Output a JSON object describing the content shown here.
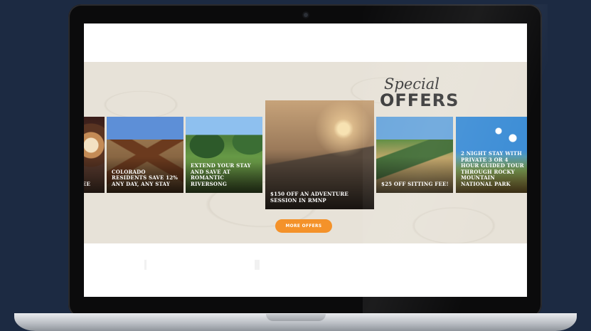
{
  "special": {
    "script": "Special",
    "offers": "OFFERS"
  },
  "offers": [
    {
      "caption": "EE"
    },
    {
      "caption": "COLORADO RESIDENTS SAVE 12% ANY DAY, ANY STAY"
    },
    {
      "caption": "EXTEND YOUR STAY AND SAVE AT ROMANTIC RIVERSONG"
    },
    {
      "caption": "$150 OFF AN ADVENTURE SESSION IN RMNP"
    },
    {
      "caption": "$25 OFF SITTING FEE!"
    },
    {
      "caption": "2 NIGHT STAY WITH PRIVATE 3 OR 4 HOUR GUIDED TOUR THROUGH ROCKY MOUNTAIN NATIONAL PARK"
    }
  ],
  "more_offers_label": "MORE OFFERS",
  "colors": {
    "accent": "#f4922a",
    "band": "#e7e2d8",
    "background": "#1c2a42"
  },
  "icons": [
    "camera-icon"
  ]
}
